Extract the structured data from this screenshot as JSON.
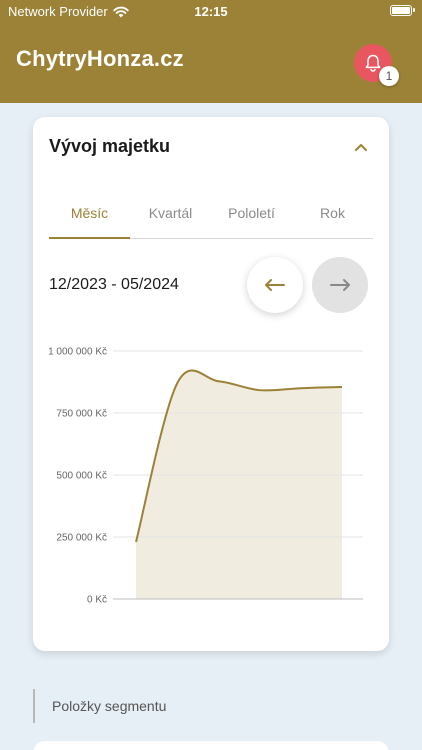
{
  "status_bar": {
    "carrier": "Network Provider",
    "time": "12:15"
  },
  "header": {
    "logo_text": "ChytryHonza.cz",
    "notification_count": "1"
  },
  "card": {
    "title": "Vývoj majetku",
    "tabs": [
      {
        "label": "Měsíc",
        "active": true
      },
      {
        "label": "Kvartál",
        "active": false
      },
      {
        "label": "Pololetí",
        "active": false
      },
      {
        "label": "Rok",
        "active": false
      }
    ],
    "range_label": "12/2023 - 05/2024"
  },
  "chart_data": {
    "type": "area",
    "x_start": "12/2023",
    "x_end": "05/2024",
    "y": [
      230000,
      870000,
      878000,
      842000,
      850000,
      855000
    ],
    "ylim": [
      0,
      1000000
    ],
    "y_ticks": [
      "0 Kč",
      "250 000 Kč",
      "500 000 Kč",
      "750 000 Kč",
      "1 000 000 Kč"
    ],
    "grid": true,
    "colors": {
      "line": "#9c8237",
      "fill": "#f1ece0"
    }
  },
  "section": {
    "label": "Položky segmentu"
  },
  "colors": {
    "brand": "#9c8237",
    "bell": "#e8575f",
    "background": "#e6eef6"
  }
}
